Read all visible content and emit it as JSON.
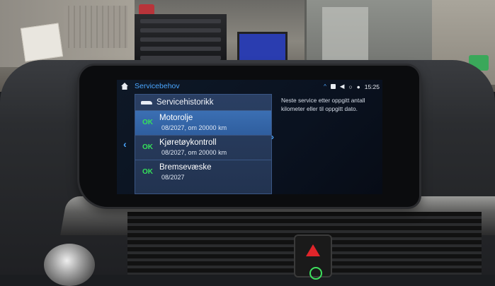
{
  "screen": {
    "title": "Servicebehov",
    "time": "15:25",
    "panel": {
      "header": "Servicehistorikk",
      "items": [
        {
          "status": "OK",
          "title": "Motorolje",
          "detail": "08/2027, om 20000 km",
          "selected": true
        },
        {
          "status": "OK",
          "title": "Kjøretøykontroll",
          "detail": "08/2027, om 20000 km",
          "selected": false
        },
        {
          "status": "OK",
          "title": "Bremsevæske",
          "detail": "08/2027",
          "selected": false
        }
      ]
    },
    "description": "Neste service etter oppgitt antall kilometer eller til oppgitt dato.",
    "icons": {
      "home": "home-icon",
      "back": "chevron-left-icon",
      "forward": "chevron-right-icon",
      "collapse": "chevron-up-icon",
      "car": "car-icon"
    },
    "colors": {
      "accent": "#4aa6ff",
      "ok": "#35e05a",
      "selection": "#3b6fb3"
    }
  }
}
